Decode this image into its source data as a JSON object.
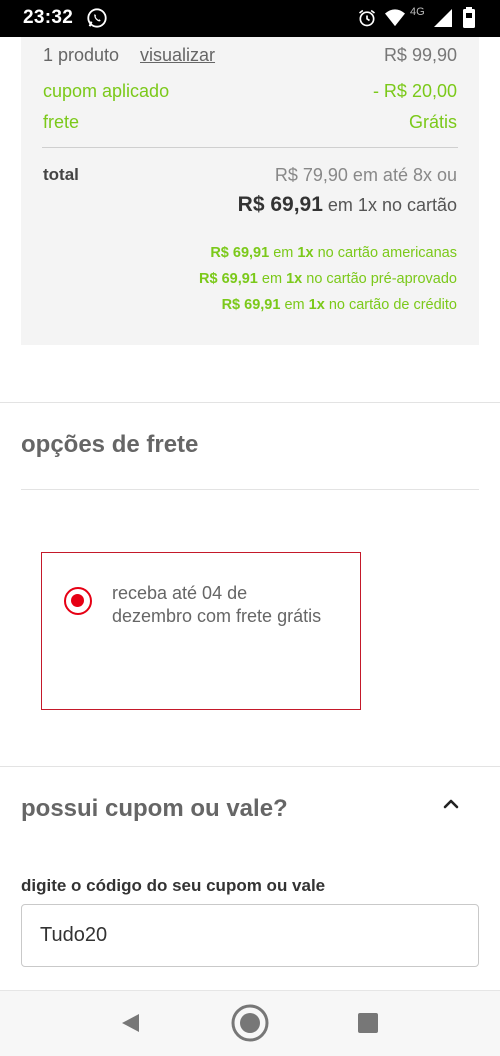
{
  "status_bar": {
    "time": "23:32",
    "network": "4G",
    "icons": [
      "whatsapp-icon",
      "alarm-icon",
      "wifi-icon",
      "signal-icon",
      "battery-icon"
    ]
  },
  "summary": {
    "produto_label": "1 produto",
    "visualizar_link": "visualizar",
    "produto_value": "R$ 99,90",
    "cupom_label": "cupom aplicado",
    "cupom_value": "- R$ 20,00",
    "frete_label": "frete",
    "frete_value": "Grátis",
    "total_label": "total",
    "total_installments": "R$ 79,90 em até 8x ou",
    "total_price": "R$ 69,91",
    "total_price_suffix": "em 1x no cartão",
    "offers": [
      {
        "price": "R$ 69,91",
        "mid": "em",
        "times": "1x",
        "suffix": "no cartão americanas"
      },
      {
        "price": "R$ 69,91",
        "mid": "em",
        "times": "1x",
        "suffix": "no cartão pré-aprovado"
      },
      {
        "price": "R$ 69,91",
        "mid": "em",
        "times": "1x",
        "suffix": "no cartão de crédito"
      }
    ]
  },
  "shipping": {
    "title": "opções de frete",
    "option_text": "receba até 04 de dezembro com frete grátis",
    "option_selected": true
  },
  "coupon": {
    "title": "possui cupom ou vale?",
    "input_label": "digite o código do seu cupom ou vale",
    "input_value": "Tudo20"
  },
  "colors": {
    "accent_green": "#7bc91a",
    "accent_red": "#e60014",
    "border_red": "#c4192a"
  },
  "nav_bar": {
    "icons": [
      "back-icon",
      "home-icon",
      "recent-apps-icon"
    ]
  }
}
